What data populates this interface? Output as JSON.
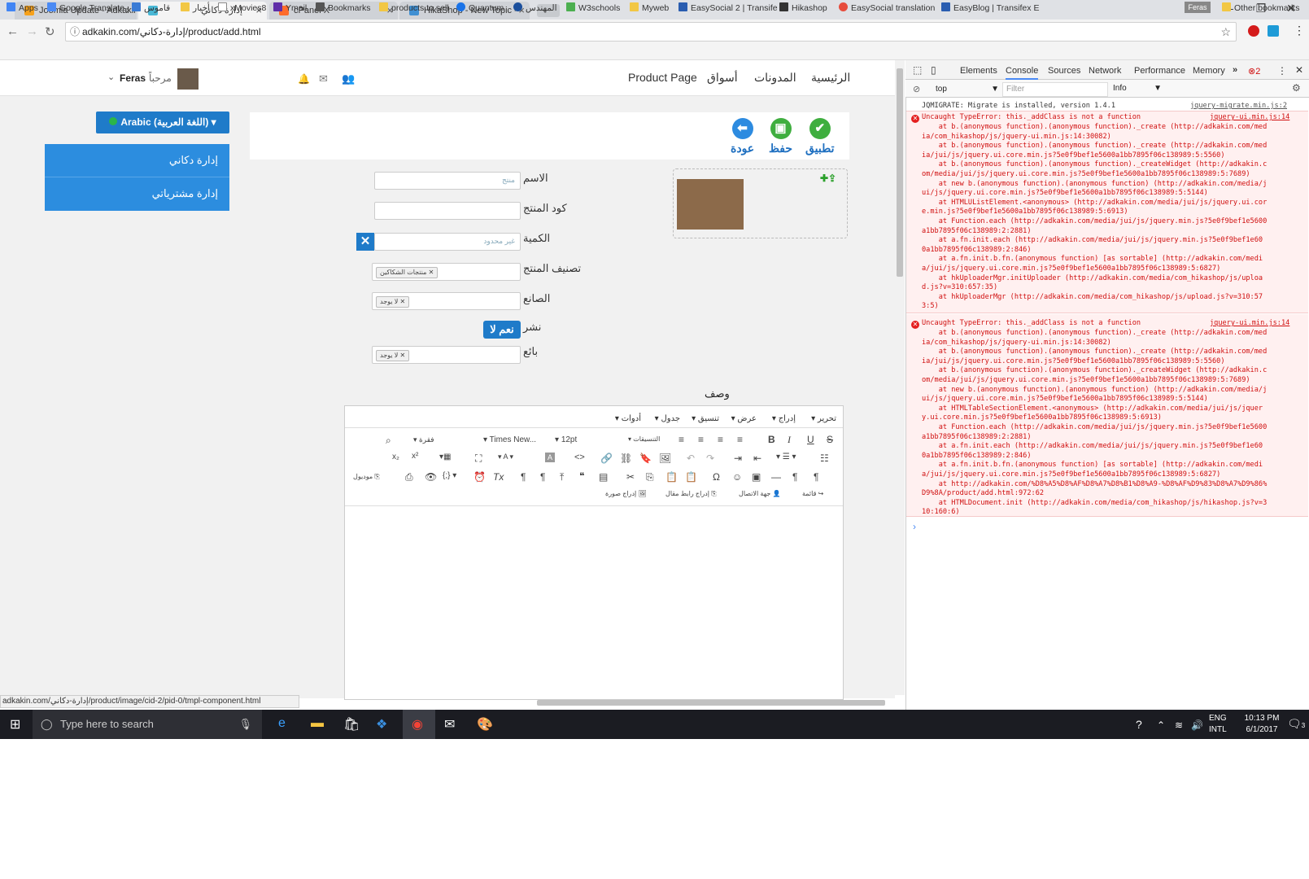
{
  "browser": {
    "tabs": [
      {
        "title": "Joomla Update - Adkakin",
        "color": "#f7a11a"
      },
      {
        "title": "إدارة دكاني",
        "color": "#49b8d6"
      },
      {
        "title": "cPanel X",
        "color": "#ff6c2c"
      },
      {
        "title": "HikaShop - New Topic - ",
        "color": "#3f8fd2"
      }
    ],
    "profile": "Feras",
    "url": "adkakin.com/إدارة-دكاني/product/add.html",
    "bookmarks": [
      "Apps",
      "Google Translate",
      "قاموس",
      "أخبار",
      "xMovies8",
      "Ymail",
      "Bookmarks",
      "products to sell",
      "Quantum",
      "المهندس",
      "W3schools",
      "Myweb",
      "EasySocial 2 | Transife",
      "Hikashop",
      "EasySocial translation",
      "EasyBlog | Transifex E",
      "Other bookmarks"
    ]
  },
  "site": {
    "nav": [
      "الرئيسية",
      "المدونات",
      "أسواق",
      "Product Page"
    ],
    "greeting": "مرحباً",
    "user": "Feras",
    "language": "Arabic (اللغة العربية)",
    "side_menu": [
      "إدارة دكاني",
      "إدارة مشترياتي"
    ],
    "toolbar": {
      "apply": "تطبيق",
      "save": "حفظ",
      "back": "عودة"
    },
    "form": {
      "name_label": "الاسم",
      "name_placeholder": "منتج",
      "code_label": "كود المنتج",
      "qty_label": "الكمية",
      "qty_value": "غير محدود",
      "category_label": "تصنيف المنتج",
      "category_chip": "منتجات الشكاكين",
      "maker_label": "الصانع",
      "maker_chip": "لا يوجد",
      "publish_label": "نشر",
      "publish_yes": "نعم",
      "publish_no": "لا",
      "seller_label": "بائع",
      "seller_chip": "لا يوجد",
      "desc_label": "وصف"
    },
    "editor": {
      "menus": [
        "تحرير",
        "إدراج",
        "عرض",
        "تنسيق",
        "جدول",
        "أدوات"
      ],
      "format": "فقرة",
      "font": "Times New...",
      "size": "12pt",
      "styles": "التنسيقات",
      "extras": [
        "قائمة",
        "جهة الاتصال",
        "إدراج رابط مقال",
        "إدراج صورة",
        "موديول"
      ]
    },
    "status_url": "adkakin.com/إدارة-دكاني/product/image/cid-2/pid-0/tmpl-component.html"
  },
  "devtools": {
    "tabs": [
      "Elements",
      "Console",
      "Sources",
      "Network",
      "Performance",
      "Memory"
    ],
    "error_count": "2",
    "context": "top",
    "filter_placeholder": "Filter",
    "level": "Info",
    "lines": [
      {
        "t": "JQMIGRATE: Migrate is installed, version 1.4.1",
        "src": "jquery-migrate.min.js:2"
      },
      {
        "t": "Uncaught TypeError: this._addClass is not a function",
        "src": "jquery-ui.min.js:14",
        "err": true
      },
      {
        "t": "    at b.(anonymous function).(anonymous function)._create (http://adkakin.com/med\nia/com_hikashop/js/jquery-ui.min.js:14:30082)\n    at b.(anonymous function).(anonymous function)._create (http://adkakin.com/med\nia/jui/js/jquery.ui.core.min.js?5e0f9bef1e5600a1bb7895f06c138989:5:5560)\n    at b.(anonymous function).(anonymous function)._createWidget (http://adkakin.c\nom/media/jui/js/jquery.ui.core.min.js?5e0f9bef1e5600a1bb7895f06c138989:5:7689)\n    at new b.(anonymous function).(anonymous function) (http://adkakin.com/media/j\nui/js/jquery.ui.core.min.js?5e0f9bef1e5600a1bb7895f06c138989:5:5144)\n    at HTMLUListElement.<anonymous> (http://adkakin.com/media/jui/js/jquery.ui.cor\ne.min.js?5e0f9bef1e5600a1bb7895f06c138989:5:6913)\n    at Function.each (http://adkakin.com/media/jui/js/jquery.min.js?5e0f9bef1e5600\na1bb7895f06c138989:2:2881)\n    at a.fn.init.each (http://adkakin.com/media/jui/js/jquery.min.js?5e0f9bef1e60\n0a1bb7895f06c138989:2:846)\n    at a.fn.init.b.fn.(anonymous function) [as sortable] (http://adkakin.com/medi\na/jui/js/jquery.ui.core.min.js?5e0f9bef1e5600a1bb7895f06c138989:5:6827)\n    at hkUploaderMgr.initUploader (http://adkakin.com/media/com_hikashop/js/uploa\nd.js?v=310:657:35)\n    at hkUploaderMgr (http://adkakin.com/media/com_hikashop/js/upload.js?v=310:57\n3:5)",
        "err": true
      },
      {
        "t": "Uncaught TypeError: this._addClass is not a function",
        "src": "jquery-ui.min.js:14",
        "err": true
      },
      {
        "t": "    at b.(anonymous function).(anonymous function)._create (http://adkakin.com/med\nia/com_hikashop/js/jquery-ui.min.js:14:30082)\n    at b.(anonymous function).(anonymous function)._create (http://adkakin.com/med\nia/jui/js/jquery.ui.core.min.js?5e0f9bef1e5600a1bb7895f06c138989:5:5560)\n    at b.(anonymous function).(anonymous function)._createWidget (http://adkakin.c\nom/media/jui/js/jquery.ui.core.min.js?5e0f9bef1e5600a1bb7895f06c138989:5:7689)\n    at new b.(anonymous function).(anonymous function) (http://adkakin.com/media/j\nui/js/jquery.ui.core.min.js?5e0f9bef1e5600a1bb7895f06c138989:5:5144)\n    at HTMLTableSectionElement.<anonymous> (http://adkakin.com/media/jui/js/jquer\ny.ui.core.min.js?5e0f9bef1e5600a1bb7895f06c138989:5:6913)\n    at Function.each (http://adkakin.com/media/jui/js/jquery.min.js?5e0f9bef1e5600\na1bb7895f06c138989:2:2881)\n    at a.fn.init.each (http://adkakin.com/media/jui/js/jquery.min.js?5e0f9bef1e60\n0a1bb7895f06c138989:2:846)\n    at a.fn.init.b.fn.(anonymous function) [as sortable] (http://adkakin.com/medi\na/jui/js/jquery.ui.core.min.js?5e0f9bef1e5600a1bb7895f06c138989:5:6827)\n    at http://adkakin.com/%D8%A5%D8%AF%D8%A7%D8%B1%D8%A9-%D8%AF%D9%83%D8%A7%D9%86%\nD9%8A/product/add.html:972:62\n    at HTMLDocument.init (http://adkakin.com/media/com_hikashop/js/hikashop.js?v=3\n10:160:6)",
        "err": true
      }
    ]
  },
  "taskbar": {
    "search_placeholder": "Type here to search",
    "lang1": "ENG",
    "lang2": "INTL",
    "time": "10:13 PM",
    "date": "6/1/2017",
    "notif_count": "3"
  }
}
